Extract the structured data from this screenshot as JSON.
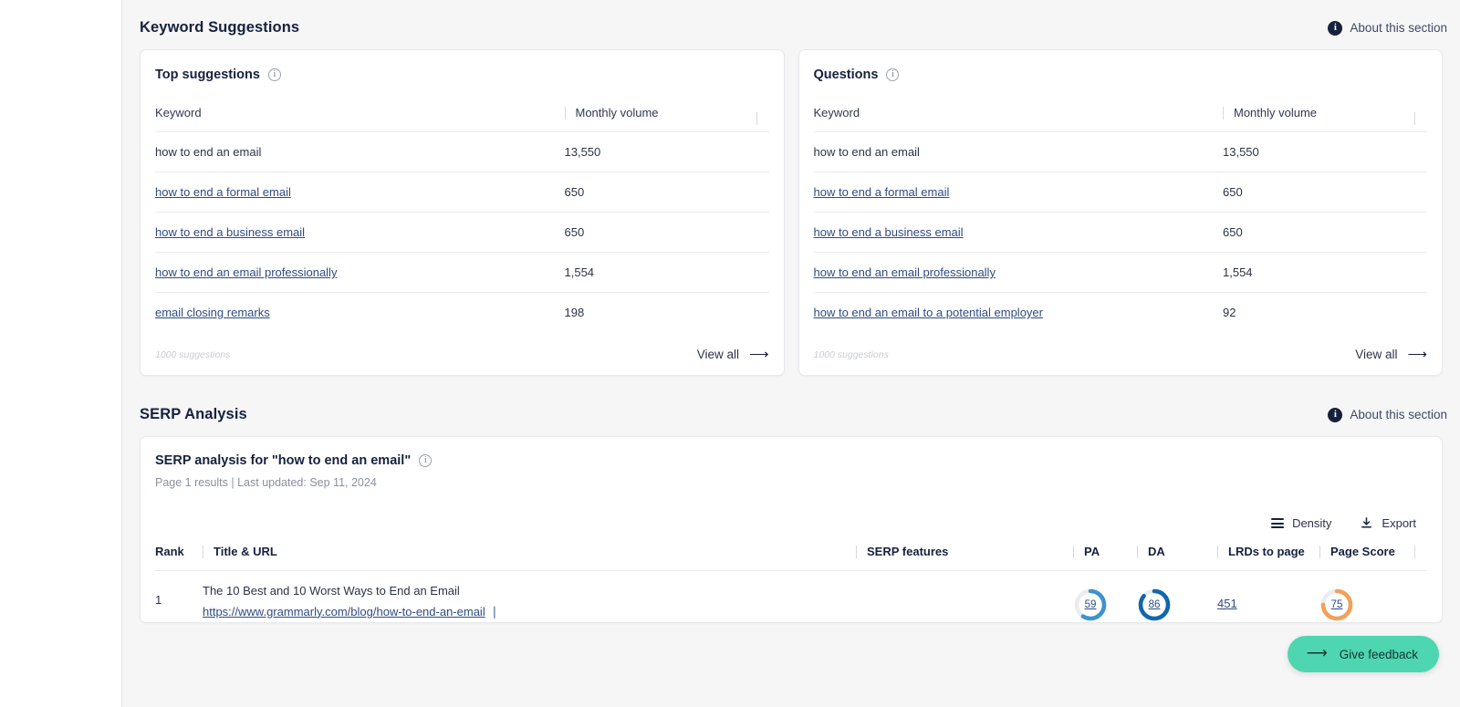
{
  "keyword_suggestions": {
    "section_title": "Keyword Suggestions",
    "about_label": "About this section",
    "top_suggestions": {
      "title": "Top suggestions",
      "columns": {
        "keyword": "Keyword",
        "volume": "Monthly volume"
      },
      "rows": [
        {
          "keyword": "how to end an email",
          "volume": "13,550",
          "is_link": false
        },
        {
          "keyword": "how to end a formal email",
          "volume": "650",
          "is_link": true
        },
        {
          "keyword": "how to end a business email",
          "volume": "650",
          "is_link": true
        },
        {
          "keyword": "how to end an email professionally",
          "volume": "1,554",
          "is_link": true
        },
        {
          "keyword": "email closing remarks",
          "volume": "198",
          "is_link": true
        }
      ],
      "footer_count": "1000 suggestions",
      "view_all": "View all"
    },
    "questions": {
      "title": "Questions",
      "columns": {
        "keyword": "Keyword",
        "volume": "Monthly volume"
      },
      "rows": [
        {
          "keyword": "how to end an email",
          "volume": "13,550",
          "is_link": false
        },
        {
          "keyword": "how to end a formal email",
          "volume": "650",
          "is_link": true
        },
        {
          "keyword": "how to end a business email",
          "volume": "650",
          "is_link": true
        },
        {
          "keyword": "how to end an email professionally",
          "volume": "1,554",
          "is_link": true
        },
        {
          "keyword": "how to end an email to a potential employer",
          "volume": "92",
          "is_link": true
        }
      ],
      "footer_count": "1000 suggestions",
      "view_all": "View all"
    }
  },
  "serp_analysis": {
    "section_title": "SERP Analysis",
    "about_label": "About this section",
    "card_title": "SERP analysis for \"how to end an email\"",
    "subtitle": "Page 1 results | Last updated: Sep 11, 2024",
    "tools": {
      "density": "Density",
      "export": "Export"
    },
    "columns": {
      "rank": "Rank",
      "title_url": "Title & URL",
      "serp_features": "SERP features",
      "pa": "PA",
      "da": "DA",
      "lrds": "LRDs to page",
      "page_score": "Page Score"
    },
    "rows": [
      {
        "rank": "1",
        "title": "The 10 Best and 10 Worst Ways to End an Email",
        "url": "https://www.grammarly.com/blog/how-to-end-an-email",
        "serp_features": "",
        "pa": "59",
        "da": "86",
        "lrds": "451",
        "page_score": "75"
      }
    ]
  },
  "feedback": {
    "label": "Give feedback"
  },
  "colors": {
    "page_bg": "#f6f6f7",
    "card_bg": "#ffffff",
    "text_dark": "#16213d",
    "link_blue": "#2f4b82",
    "pa_ring": "#3d93cf",
    "da_ring": "#1167ad",
    "page_score_ring": "#f2a15a",
    "ring_track": "#ebecef",
    "feedback_teal": "#4ed6b0"
  },
  "gauges": {
    "pa_pct": 59,
    "da_pct": 86,
    "page_score_pct": 75
  }
}
